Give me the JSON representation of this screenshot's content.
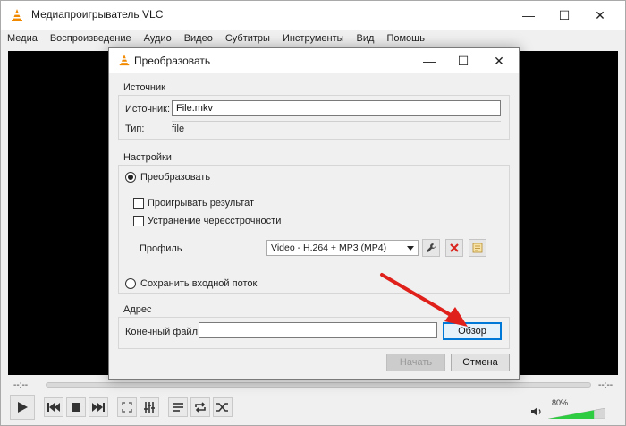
{
  "window": {
    "title": "Медиапроигрыватель VLC",
    "minimize_glyph": "—",
    "maximize_glyph": "☐",
    "close_glyph": "✕"
  },
  "menu": {
    "items": [
      "Медиа",
      "Воспроизведение",
      "Аудио",
      "Видео",
      "Субтитры",
      "Инструменты",
      "Вид",
      "Помощь"
    ]
  },
  "dialog": {
    "title": "Преобразовать",
    "source_group": {
      "label": "Источник",
      "source_label": "Источник:",
      "source_value": "File.mkv",
      "type_label": "Тип:",
      "type_value": "file"
    },
    "settings_group": {
      "label": "Настройки",
      "convert_label": "Преобразовать",
      "play_result_label": "Проигрывать результат",
      "deinterlace_label": "Устранение чересстрочности",
      "profile_label": "Профиль",
      "profile_value": "Video - H.264 + MP3 (MP4)",
      "keep_stream_label": "Сохранить входной поток",
      "convert_selected": true,
      "play_result_checked": false,
      "deinterlace_checked": false
    },
    "address_group": {
      "label": "Адрес",
      "dest_label": "Конечный файл:",
      "dest_value": "",
      "browse_label": "Обзор"
    },
    "start_label": "Начать",
    "cancel_label": "Отмена"
  },
  "player": {
    "time_elapsed": "--:--",
    "time_total": "--:--",
    "volume_percent": "80%",
    "volume_level": 0.8
  },
  "colors": {
    "accent": "#0078d7",
    "arrow": "#e0201b",
    "delete_icon": "#d9231c",
    "volume_fill": "#2ecc40",
    "vlc_cone": "#f28a00"
  }
}
